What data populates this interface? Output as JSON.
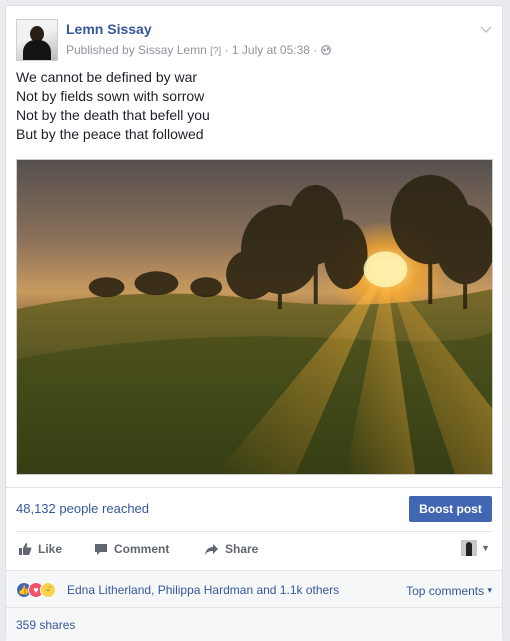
{
  "post": {
    "author": "Lemn Sissay",
    "published_by": "Published by Sissay Lemn",
    "help_marker": "[?]",
    "separator": "·",
    "timestamp": "1 July at 05:38",
    "privacy_icon": "globe-icon",
    "menu_icon": "chevron-down-icon",
    "message_lines": [
      "We cannot be defined by war",
      "Not by fields sown with sorrow",
      "Not by the death that befell you",
      "But by the peace that followed"
    ],
    "photo_description_icon": "landscape-photo"
  },
  "insights": {
    "reach_text": "48,132 people reached",
    "boost_label": "Boost post"
  },
  "actions": {
    "like": "Like",
    "comment": "Comment",
    "share": "Share"
  },
  "reactions": {
    "summary": "Edna Litherland, Philippa Hardman and 1.1k others",
    "top_comments": "Top comments",
    "top_comments_caret": "▾"
  },
  "shares": {
    "text": "359 shares"
  },
  "colors": {
    "link": "#365899",
    "boost_bg": "#4267b2",
    "like": "#4267b2",
    "love": "#f25268",
    "sad": "#fcd24d"
  }
}
